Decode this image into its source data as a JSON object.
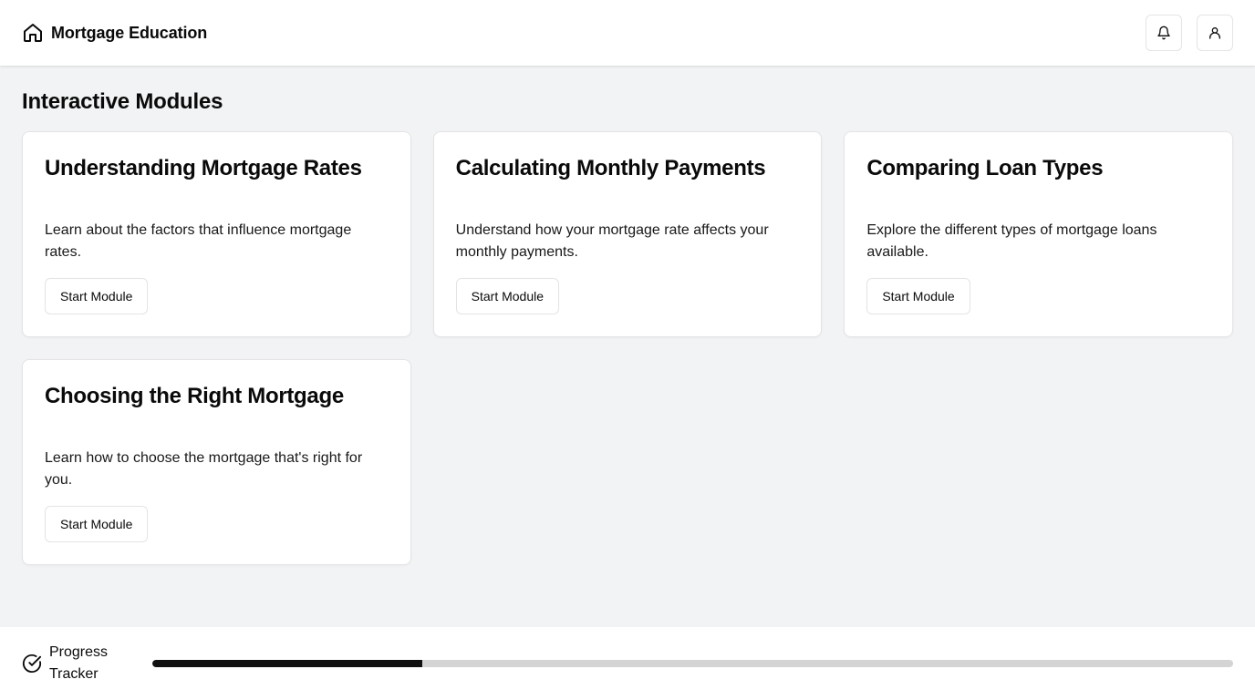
{
  "header": {
    "title": "Mortgage Education",
    "logo_icon": "home-icon",
    "actions": [
      {
        "icon": "bell-icon"
      },
      {
        "icon": "user-icon"
      }
    ]
  },
  "main": {
    "section_title": "Interactive Modules",
    "modules": [
      {
        "title": "Understanding Mortgage Rates",
        "description": "Learn about the factors that influence mortgage rates.",
        "button_label": "Start Module"
      },
      {
        "title": "Calculating Monthly Payments",
        "description": "Understand how your mortgage rate affects your monthly payments.",
        "button_label": "Start Module"
      },
      {
        "title": "Comparing Loan Types",
        "description": "Explore the different types of mortgage loans available.",
        "button_label": "Start Module"
      },
      {
        "title": "Choosing the Right Mortgage",
        "description": "Learn how to choose the mortgage that's right for you.",
        "button_label": "Start Module"
      }
    ]
  },
  "footer": {
    "tracker_icon": "check-circle-icon",
    "tracker_label": "Progress Tracker",
    "progress_fraction": 0.25,
    "colors": {
      "fill": "#111111",
      "track": "#d4d4d4"
    }
  }
}
